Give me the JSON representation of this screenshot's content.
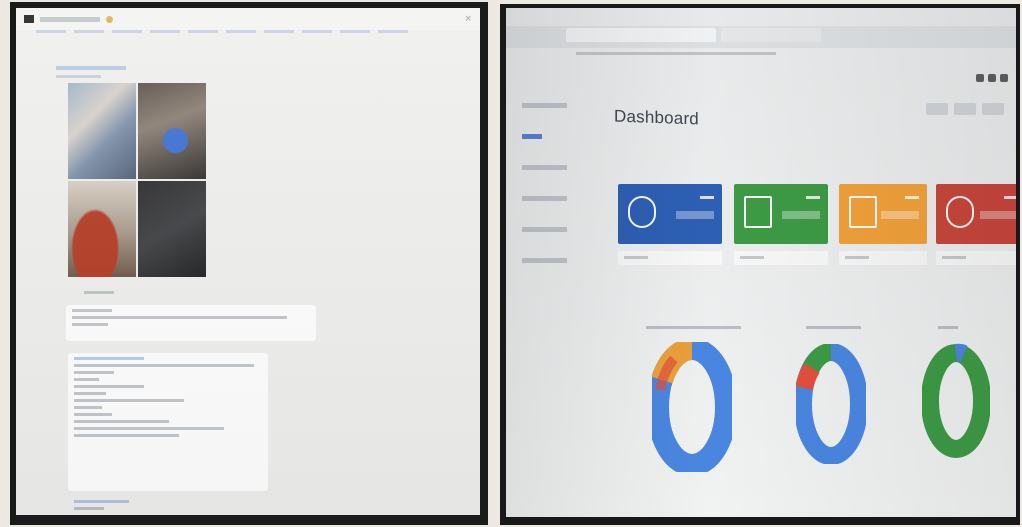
{
  "left_photo": {
    "chat_images": [
      "image-tile-1",
      "image-tile-2",
      "image-tile-3",
      "image-tile-4"
    ],
    "icons": [
      "avatar-icon",
      "emoji-icon",
      "close-icon"
    ]
  },
  "right_photo": {
    "page_title": "Dashboard",
    "cards": [
      {
        "color": "#2d5fb4",
        "icon": "chat-icon"
      },
      {
        "color": "#3d9a45",
        "icon": "list-icon"
      },
      {
        "color": "#f0a03a",
        "icon": "document-icon"
      },
      {
        "color": "#c7463c",
        "icon": "lifebuoy-icon"
      }
    ],
    "donut_colors": {
      "blue": "#4a86e0",
      "orange": "#e9a03b",
      "red": "#e0503c",
      "green": "#3d9a45"
    }
  }
}
